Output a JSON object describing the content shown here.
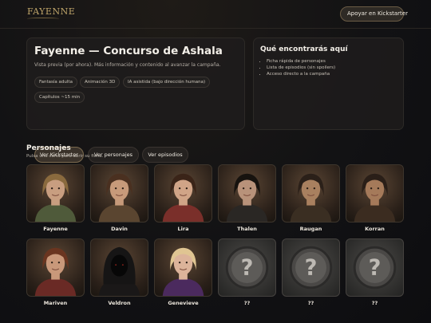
{
  "header": {
    "logo": "FAYENNE",
    "kickstarter_label": "Apoyar en Kickstarter"
  },
  "hero": {
    "title": "Fayenne — Concurso de Ashala",
    "subtitle": "Vista previa (por ahora). Más información y contenido al avanzar la campaña.",
    "tags": [
      "Fantasía adulta",
      "Animación 3D",
      "IA asistida (bajo dirección humana)",
      "Capítulos ~15 min"
    ],
    "buttons": {
      "kickstarter": "Ver Kickstarter",
      "characters": "Ver personajes",
      "episodes": "Ver episodios"
    }
  },
  "side": {
    "title": "Qué encontrarás aquí",
    "items": [
      "Ficha rápida de personajes",
      "Lista de episodios (sin spoilers)",
      "Acceso directo a la campaña"
    ]
  },
  "characters": {
    "title": "Personajes",
    "subtitle": "Pulsa una carta para abrir su ficha.",
    "cards": [
      {
        "name": "Fayenne",
        "hair": "#8a6a3e",
        "skin": "#c89e80",
        "cloth": "#4f5a3a"
      },
      {
        "name": "Davin",
        "hair": "#4a3020",
        "skin": "#c79a7a",
        "cloth": "#5a4530"
      },
      {
        "name": "Lira",
        "hair": "#3a2418",
        "skin": "#d0a487",
        "cloth": "#7a2f2a"
      },
      {
        "name": "Thalen",
        "hair": "#17130f",
        "skin": "#b8927a",
        "cloth": "#2a2724"
      },
      {
        "name": "Raugan",
        "hair": "#2b2019",
        "skin": "#a9805f",
        "cloth": "#3a2e22"
      },
      {
        "name": "Korran",
        "hair": "#2a1f18",
        "skin": "#a57a5a",
        "cloth": "#3b2c20"
      },
      {
        "name": "Mariven",
        "hair": "#6a3520",
        "skin": "#c9987a",
        "cloth": "#6a2a25"
      },
      {
        "name": "Veldron",
        "hair": "#0c0c0d",
        "skin": "#141313",
        "cloth": "#1a1818"
      },
      {
        "name": "Genevieve",
        "hair": "#e0c592",
        "skin": "#dcb39a",
        "cloth": "#4b2a5e"
      },
      {
        "name": "??",
        "unknown": true
      },
      {
        "name": "??",
        "unknown": true
      },
      {
        "name": "??",
        "unknown": true
      }
    ]
  }
}
